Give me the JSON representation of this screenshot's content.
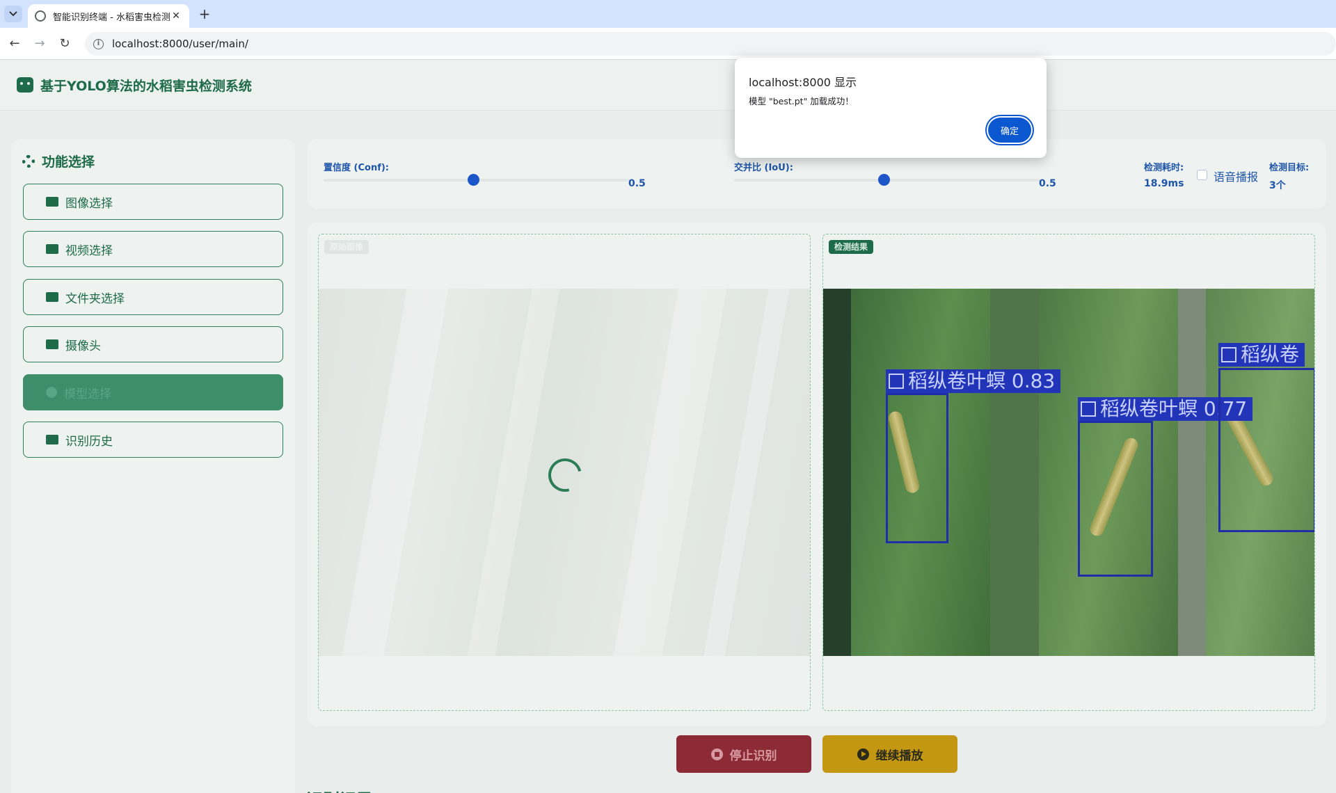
{
  "browser": {
    "tab_title": "智能识别终端 - 水稻害虫检测系",
    "tab_close": "✕",
    "new_tab": "+",
    "url": "localhost:8000/user/main/"
  },
  "header": {
    "title": "基于YOLO算法的水稻害虫检测系统",
    "icon": "robot-icon"
  },
  "sidebar": {
    "title": "功能选择",
    "items": [
      {
        "label": "图像选择",
        "icon": "image-icon"
      },
      {
        "label": "视频选择",
        "icon": "video-icon"
      },
      {
        "label": "文件夹选择",
        "icon": "folder-icon"
      },
      {
        "label": "摄像头",
        "icon": "camera-icon"
      },
      {
        "label": "模型选择",
        "icon": "brain-icon",
        "active": true
      },
      {
        "label": "识别历史",
        "icon": "history-icon"
      }
    ]
  },
  "params": {
    "conf_label": "置信度 (Conf):",
    "conf_value": "0.5",
    "iou_label": "交并比 (IoU):",
    "iou_value": "0.5",
    "time_label": "检测耗时:",
    "time_value": "18.9ms",
    "voice_label": "语音播报",
    "voice_checked": false,
    "target_label": "检测目标:",
    "target_value": "3个"
  },
  "panels": {
    "original_badge": "原始图像",
    "result_badge": "检测结果",
    "detections": [
      {
        "label": "稻纵卷叶螟 0.83"
      },
      {
        "label": "稻纵卷叶螟 0.77"
      },
      {
        "label": "稻纵卷"
      }
    ]
  },
  "buttons": {
    "stop": "停止识别",
    "continue": "继续播放"
  },
  "bottom_heading": "识别记录",
  "dialog": {
    "title": "localhost:8000 显示",
    "message": "模型 \"best.pt\" 加载成功！",
    "ok": "确定"
  },
  "colors": {
    "primary_green": "#1d6b48",
    "accent_blue": "#1e55a8",
    "stop_red": "#8c2a35",
    "play_yellow": "#c49712",
    "dialog_button": "#0b57d0"
  }
}
